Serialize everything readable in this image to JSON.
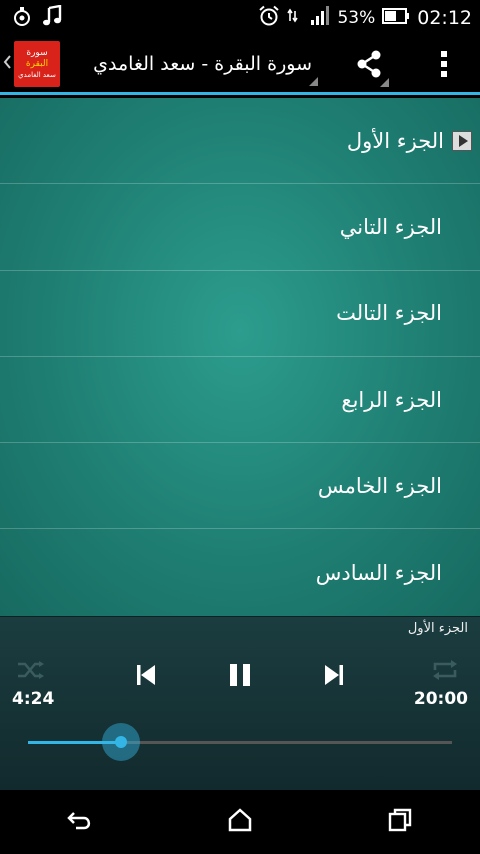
{
  "status_bar": {
    "battery_percent": "53%",
    "time": "02:12",
    "icons": [
      "notification-app-icon",
      "music-note-icon",
      "alarm-icon",
      "wifi-icon",
      "signal-icon",
      "battery-icon"
    ]
  },
  "action_bar": {
    "logo_lines": [
      "سورة",
      "البقرة",
      "سعد الغامدي"
    ],
    "title": "سورة البقرة - سعد الغامدي",
    "icons": [
      "back-chevron-icon",
      "share-icon",
      "overflow-menu-icon"
    ]
  },
  "parts": [
    {
      "label": "الجزء الأول",
      "playing": true
    },
    {
      "label": "الجزء التاني",
      "playing": false
    },
    {
      "label": "الجزء التالت",
      "playing": false
    },
    {
      "label": "الجزء الرابع",
      "playing": false
    },
    {
      "label": "الجزء الخامس",
      "playing": false
    },
    {
      "label": "الجزء السادس",
      "playing": false
    }
  ],
  "player": {
    "now_playing": "الجزء الأول",
    "elapsed": "4:24",
    "duration": "20:00",
    "progress_percent": 22,
    "icons": [
      "shuffle-icon",
      "previous-icon",
      "pause-icon",
      "next-icon",
      "repeat-icon"
    ]
  },
  "nav_bar": {
    "icons": [
      "back-icon",
      "home-icon",
      "recents-icon"
    ]
  },
  "colors": {
    "accent": "#33b5e5",
    "list_bg": "#1f7f73",
    "logo_bg": "#d8221a"
  }
}
